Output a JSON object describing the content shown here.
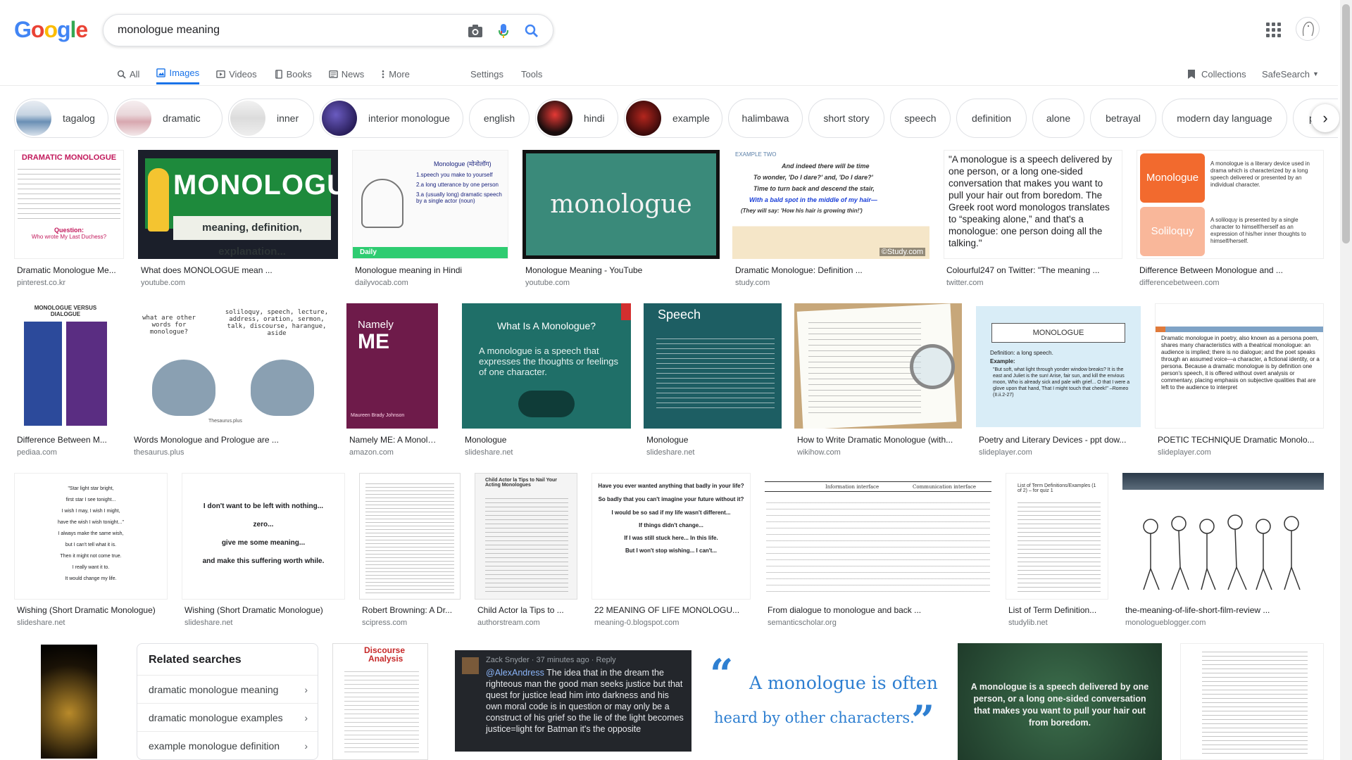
{
  "search": {
    "query": "monologue meaning",
    "logo_letters": [
      "G",
      "o",
      "o",
      "g",
      "l",
      "e"
    ],
    "logo_colors": [
      "#4285f4",
      "#ea4335",
      "#fbbc05",
      "#4285f4",
      "#34a853",
      "#ea4335"
    ]
  },
  "tabs": [
    {
      "label": "All",
      "icon": "search-icon"
    },
    {
      "label": "Images",
      "icon": "image-icon",
      "active": true
    },
    {
      "label": "Videos",
      "icon": "play-icon"
    },
    {
      "label": "Books",
      "icon": "book-icon"
    },
    {
      "label": "News",
      "icon": "news-icon"
    },
    {
      "label": "More",
      "icon": "more-vert-icon"
    }
  ],
  "tools": {
    "settings": "Settings",
    "tools": "Tools",
    "collections": "Collections",
    "safesearch": "SafeSearch"
  },
  "chips": [
    "tagalog",
    "dramatic",
    "inner",
    "interior monologue",
    "english",
    "hindi",
    "example",
    "halimbawa",
    "short story",
    "speech",
    "definition",
    "alone",
    "betrayal",
    "modern day language",
    "poem"
  ],
  "results": [
    {
      "title": "Dramatic Monologue Me...",
      "source": "pinterest.co.kr",
      "overlay": [
        "DRAMATIC MONOLOGUE",
        "Question:",
        "Who wrote My Last Duchess?"
      ]
    },
    {
      "title": "What does MONOLOGUE mean ...",
      "source": "youtube.com",
      "overlay": [
        "MONOLOGUE",
        "meaning, definition, explanation..."
      ]
    },
    {
      "title": "Monologue meaning in Hindi",
      "source": "dailyvocab.com",
      "overlay": [
        "Monologue (मोनोलॉग)",
        "1.speech you make to yourself",
        "2.a long utterance by one person",
        "3.a (usually long) dramatic speech by a single actor (noun)",
        "Daily"
      ]
    },
    {
      "title": "Monologue Meaning - YouTube",
      "source": "youtube.com",
      "overlay": [
        "monologue"
      ]
    },
    {
      "title": "Dramatic Monologue: Definition ...",
      "source": "study.com",
      "overlay": [
        "EXAMPLE TWO",
        "And indeed there will be time",
        "To wonder, 'Do I dare?' and, 'Do I dare?'",
        "Time to turn back and descend the stair,",
        "With a bald spot in the middle of my hair—",
        "(They will say: 'How his hair is growing thin!')",
        "©Study.com"
      ]
    },
    {
      "title": "Colourful247 on Twitter: \"The meaning ...",
      "source": "twitter.com",
      "overlay": [
        "\"A monologue is a speech delivered by one person, or a long one-sided conversation that makes you want to pull your hair out from boredom. The Greek root word monologos translates to “speaking alone,” and that's a monologue: one person doing all the talking.\""
      ]
    },
    {
      "title": "Difference Between Monologue and ...",
      "source": "differencebetween.com",
      "overlay": [
        "Monologue",
        "Soliloquy",
        "A monologue is a literary device used in drama which is characterized by a long speech delivered or presented by an individual character.",
        "A soliloquy is presented by a single character to himself/herself as an expression of his/her inner thoughts to himself/herself."
      ]
    },
    {
      "title": "Difference Between M...",
      "source": "pediaa.com",
      "overlay": [
        "MONOLOGUE VERSUS DIALOGUE"
      ]
    },
    {
      "title": "Words Monologue and Prologue are ...",
      "source": "thesaurus.plus",
      "overlay": [
        "what are other words for monologue?",
        "soliloquy, speech, lecture, address, oration, sermon, talk, discourse, harangue, aside",
        "Thesaurus.plus"
      ]
    },
    {
      "title": "Namely ME: A Monolo...",
      "source": "amazon.com",
      "overlay": [
        "Namely",
        "ME",
        "Maureen Brady Johnson"
      ]
    },
    {
      "title": "Monologue",
      "source": "slideshare.net",
      "overlay": [
        "What Is A Monologue?",
        "A monologue is a speech that expresses the thoughts or feelings of one character."
      ]
    },
    {
      "title": "Monologue",
      "source": "slideshare.net",
      "overlay": [
        "Speech"
      ]
    },
    {
      "title": "How to Write Dramatic Monologue (with...",
      "source": "wikihow.com",
      "overlay": []
    },
    {
      "title": "Poetry and Literary Devices - ppt dow...",
      "source": "slideplayer.com",
      "overlay": [
        "MONOLOGUE",
        "Definition: a long speech.",
        "Example:",
        "\"But soft, what light through yonder window breaks? It is the east and Juliet is the sun! Arise, fair sun, and kill the envious moon, Who is already sick and pale with grief... O that I were a glove upon that hand, That I might touch that cheek!\" –Romeo (II.ii.2-27)"
      ]
    },
    {
      "title": "POETIC TECHNIQUE Dramatic Monolo...",
      "source": "slideplayer.com",
      "overlay": [
        "Dramatic monologue in poetry, also known as a persona poem, shares many characteristics with a theatrical monologue: an audience is implied; there is no dialogue; and the poet speaks through an assumed voice—a character, a fictional identity, or a persona. Because a dramatic monologue is by definition one person's speech, it is offered without overt analysis or commentary, placing emphasis on subjective qualities that are left to the audience to interpret"
      ]
    },
    {
      "title": "Wishing (Short Dramatic Monologue)",
      "source": "slideshare.net",
      "overlay": [
        "\"Star light star bright,",
        "first star I see tonight...",
        "I wish I may, I wish I might,",
        "have the wish I wish tonight...\"",
        "I always make the same wish,",
        "but I can't tell what it is.",
        "Then it might not come true.",
        "I really want it to.",
        "It would change my life."
      ]
    },
    {
      "title": "Wishing (Short Dramatic Monologue)",
      "source": "slideshare.net",
      "overlay": [
        "I don't want to be left with nothing...",
        "zero...",
        "give me some meaning...",
        "and make this suffering worth while."
      ]
    },
    {
      "title": "Robert Browning: A Dr...",
      "source": "scipress.com",
      "overlay": []
    },
    {
      "title": "Child Actor la Tips to ...",
      "source": "authorstream.com",
      "overlay": [
        "Child Actor la Tips to Nail Your Acting Monologues"
      ]
    },
    {
      "title": "22 MEANING OF LIFE MONOLOGU...",
      "source": "meaning-0.blogspot.com",
      "overlay": [
        "Have you ever wanted anything that badly in your life?",
        "So badly that you can't imagine your future without it?",
        "I would be so sad if my life wasn't different...",
        "If things didn't change...",
        "If I was still stuck here... In this life.",
        "But I won't stop wishing... I can't..."
      ]
    },
    {
      "title": "From dialogue to monologue and back ...",
      "source": "semanticscholar.org",
      "overlay": [
        "Information interface",
        "Communication interface"
      ]
    },
    {
      "title": "List of Term Definition...",
      "source": "studylib.net",
      "overlay": [
        "List of Term Definitions/Examples (1 of 2) – for quiz 1"
      ]
    },
    {
      "title": "the-meaning-of-life-short-film-review ...",
      "source": "monologueblogger.com",
      "overlay": []
    }
  ],
  "bottom_row": {
    "discourse": [
      "Discourse",
      "Analysis"
    ],
    "tweet": {
      "header": "Zack Snyder · 37 minutes ago · Reply",
      "handle": "@AlexAndress",
      "body": "The idea that in the dream the righteous man the good man seeks justice but that quest for justice lead him into darkness and his own moral code is in question or may only be a construct of his grief so the lie of the light becomes justice=light for Batman it's the opposite"
    },
    "quote": [
      "A monologue is often",
      "heard by other characters."
    ],
    "chalk": "A monologue is a speech delivered by one person, or a long one-sided conversation that makes you want to pull your hair out from boredom."
  },
  "related": {
    "heading": "Related searches",
    "items": [
      "dramatic monologue meaning",
      "dramatic monologue examples",
      "example monologue definition"
    ]
  }
}
